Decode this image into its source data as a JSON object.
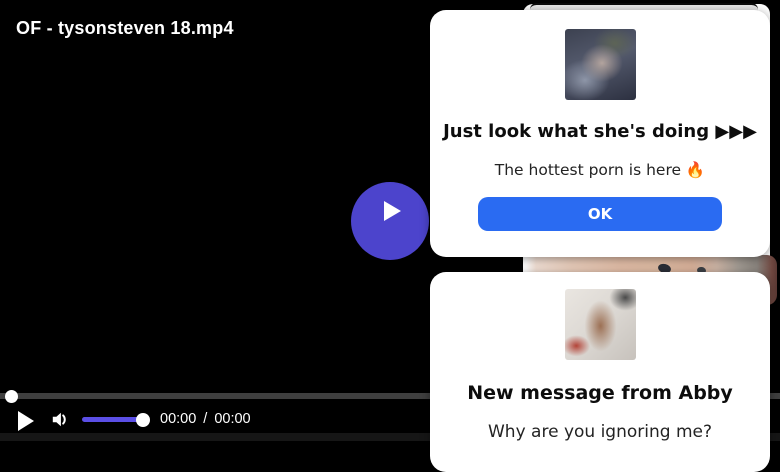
{
  "player": {
    "title": "OF - tysonsteven 18.mp4",
    "controls": {
      "play_icon": "play-icon",
      "volume_icon": "volume-low-icon",
      "current_time": "00:00",
      "separator": "/",
      "duration": "00:00"
    },
    "seek": {
      "progress_percent": 0
    }
  },
  "overlays": {
    "ad_popup": {
      "thumbnail": "ad-photo-thumbnail",
      "heading": "Just look what she's doing ▶▶▶",
      "subtext": "The hottest porn is here 🔥",
      "ok_label": "OK"
    },
    "message_popup": {
      "thumbnail": "message-photo-thumbnail",
      "heading": "New message from Abby",
      "subtext": "Why are you ignoring me?"
    }
  },
  "colors": {
    "play_button": "#4c44cc",
    "volume_fill": "#5b4fe6",
    "ok_button": "#2a6bf2",
    "seek_track": "#3f3f3f"
  }
}
